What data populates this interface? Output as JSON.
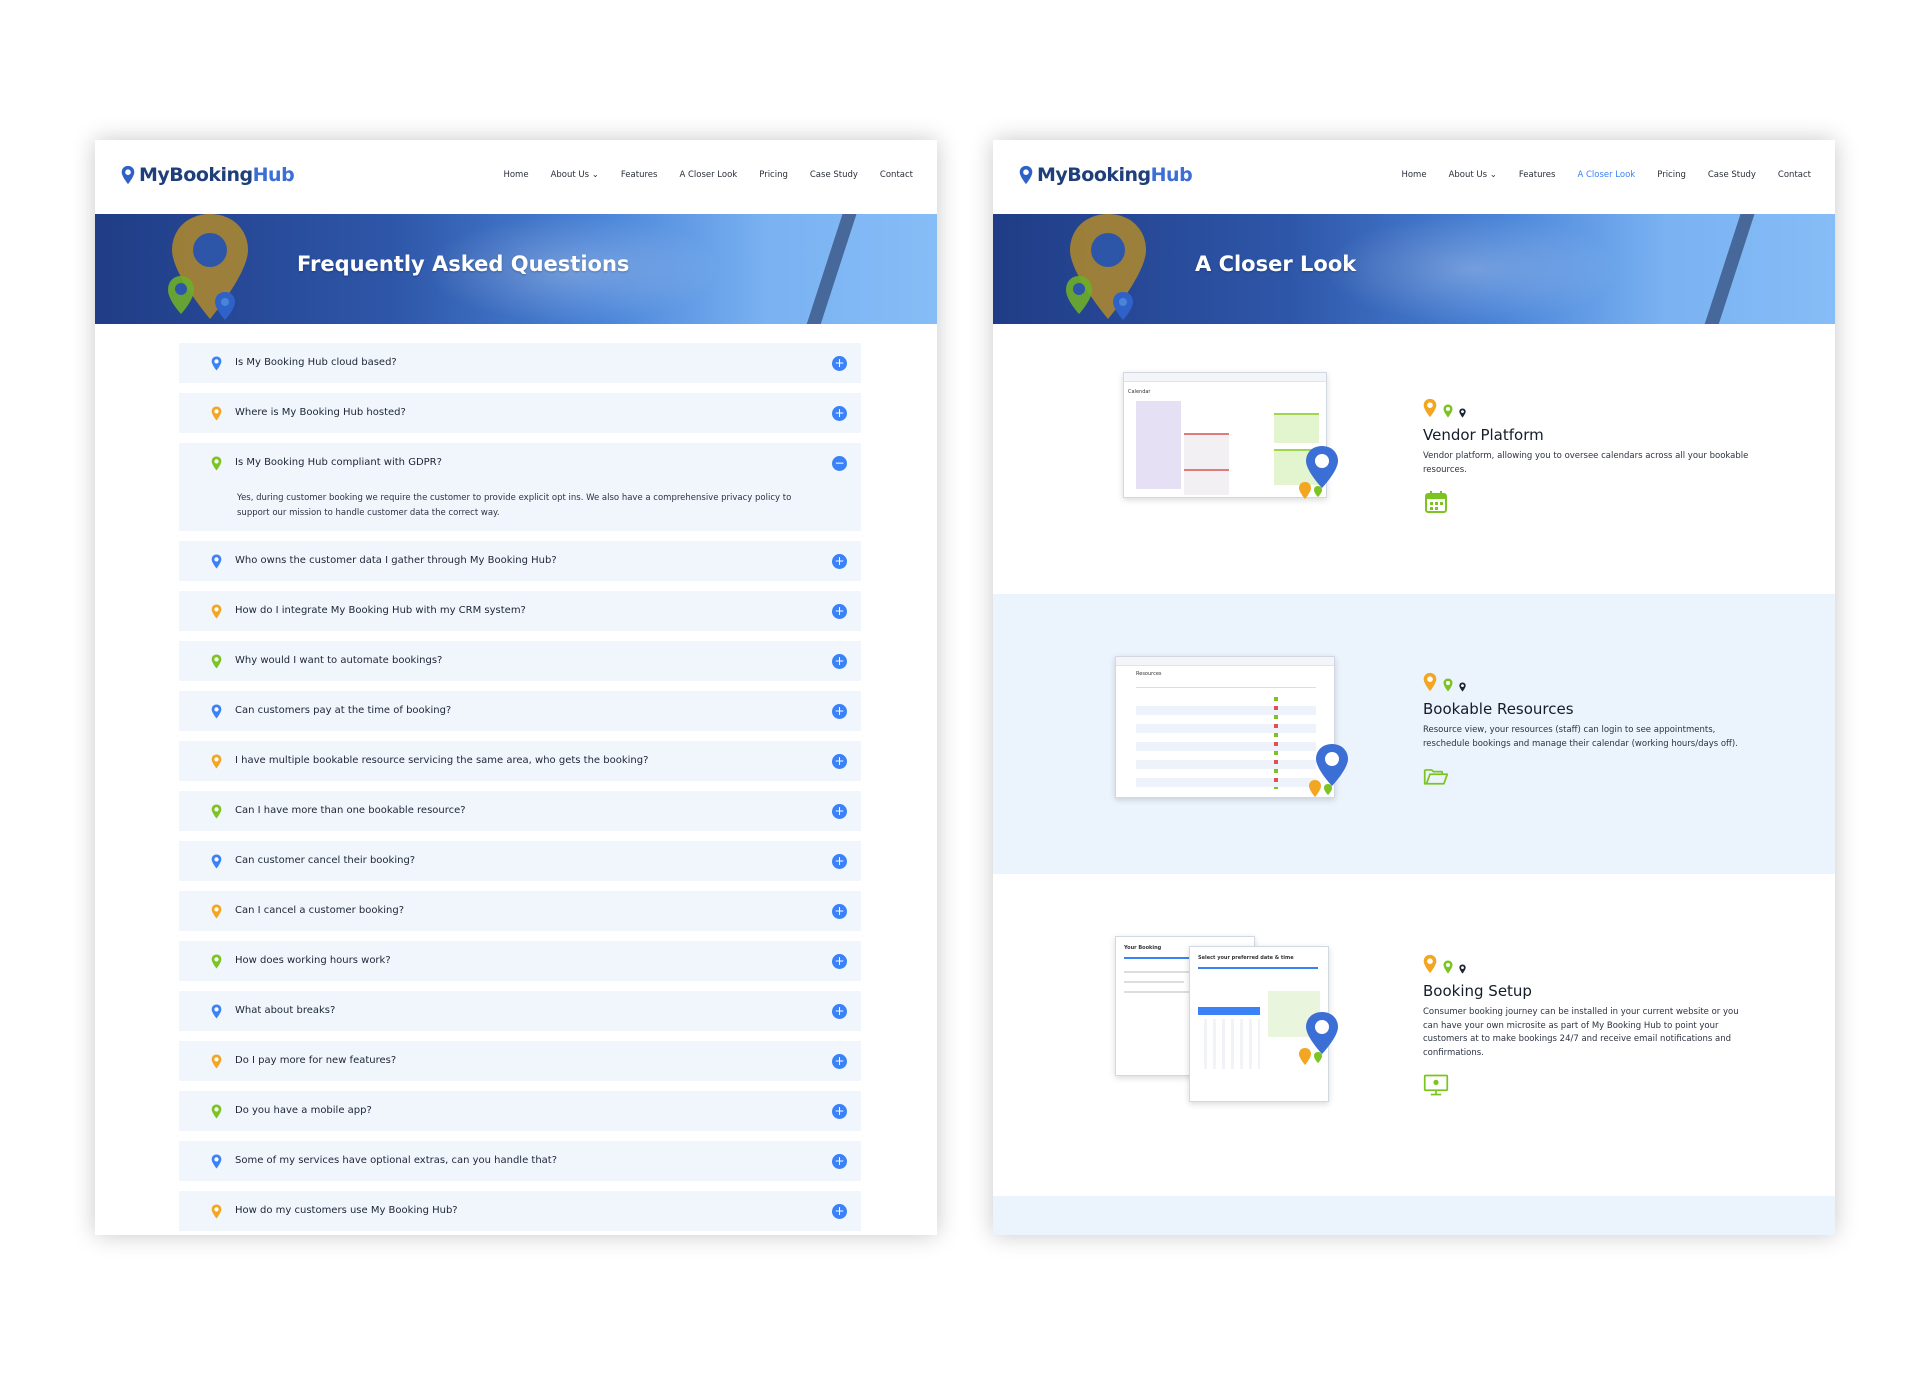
{
  "brand": {
    "my": "MyBooking",
    "hub": "Hub"
  },
  "nav": [
    "Home",
    "About Us ⌄",
    "Features",
    "A Closer Look",
    "Pricing",
    "Case Study",
    "Contact"
  ],
  "colors": {
    "blue": "#3b82f6",
    "orange": "#f2a622",
    "green": "#7cc422",
    "navy": "#1f3f7a",
    "faq_bg": "#f1f6fd"
  },
  "faq_page": {
    "banner_title": "Frequently Asked Questions",
    "items": [
      {
        "q": "Is My Booking Hub cloud based?",
        "pin": "blue",
        "toggle": "+"
      },
      {
        "q": "Where is My Booking Hub hosted?",
        "pin": "orange",
        "toggle": "+"
      },
      {
        "q": "Is My Booking Hub compliant with GDPR?",
        "pin": "green",
        "toggle": "−",
        "answer": "Yes, during customer booking we require the customer to provide explicit opt ins. We also have a comprehensive privacy policy to support our mission to handle customer data the correct way."
      },
      {
        "q": "Who owns the customer data I gather through My Booking Hub?",
        "pin": "blue",
        "toggle": "+"
      },
      {
        "q": "How do I integrate My Booking Hub with my CRM system?",
        "pin": "orange",
        "toggle": "+"
      },
      {
        "q": "Why would I want to automate bookings?",
        "pin": "green",
        "toggle": "+"
      },
      {
        "q": "Can customers pay at the time of booking?",
        "pin": "blue",
        "toggle": "+"
      },
      {
        "q": "I have multiple bookable resource servicing the same area, who gets the booking?",
        "pin": "orange",
        "toggle": "+"
      },
      {
        "q": "Can I have more than one bookable resource?",
        "pin": "green",
        "toggle": "+"
      },
      {
        "q": "Can customer cancel their booking?",
        "pin": "blue",
        "toggle": "+"
      },
      {
        "q": "Can I cancel a customer booking?",
        "pin": "orange",
        "toggle": "+"
      },
      {
        "q": "How does working hours work?",
        "pin": "green",
        "toggle": "+"
      },
      {
        "q": "What about breaks?",
        "pin": "blue",
        "toggle": "+"
      },
      {
        "q": "Do I pay more for new features?",
        "pin": "orange",
        "toggle": "+"
      },
      {
        "q": "Do you have a mobile app?",
        "pin": "green",
        "toggle": "+"
      },
      {
        "q": "Some of my services have optional extras, can you handle that?",
        "pin": "blue",
        "toggle": "+"
      },
      {
        "q": "How do my customers use My Booking Hub?",
        "pin": "orange",
        "toggle": "+"
      }
    ]
  },
  "closer_page": {
    "banner_title": "A Closer Look",
    "features": [
      {
        "title": "Vendor Platform",
        "desc": "Vendor platform, allowing you to oversee calendars across all your bookable resources.",
        "icon": "calendar-icon"
      },
      {
        "title": "Bookable Resources",
        "desc": "Resource view, your resources (staff) can login to see appointments, reschedule bookings and manage their calendar (working hours/days off).",
        "icon": "folder-icon"
      },
      {
        "title": "Booking Setup",
        "desc": "Consumer booking journey can be installed in your current website or you can have your own microsite as part of My Booking Hub to point your customers at to make bookings 24/7 and receive email notifications and confirmations.",
        "icon": "monitor-icon"
      }
    ]
  }
}
